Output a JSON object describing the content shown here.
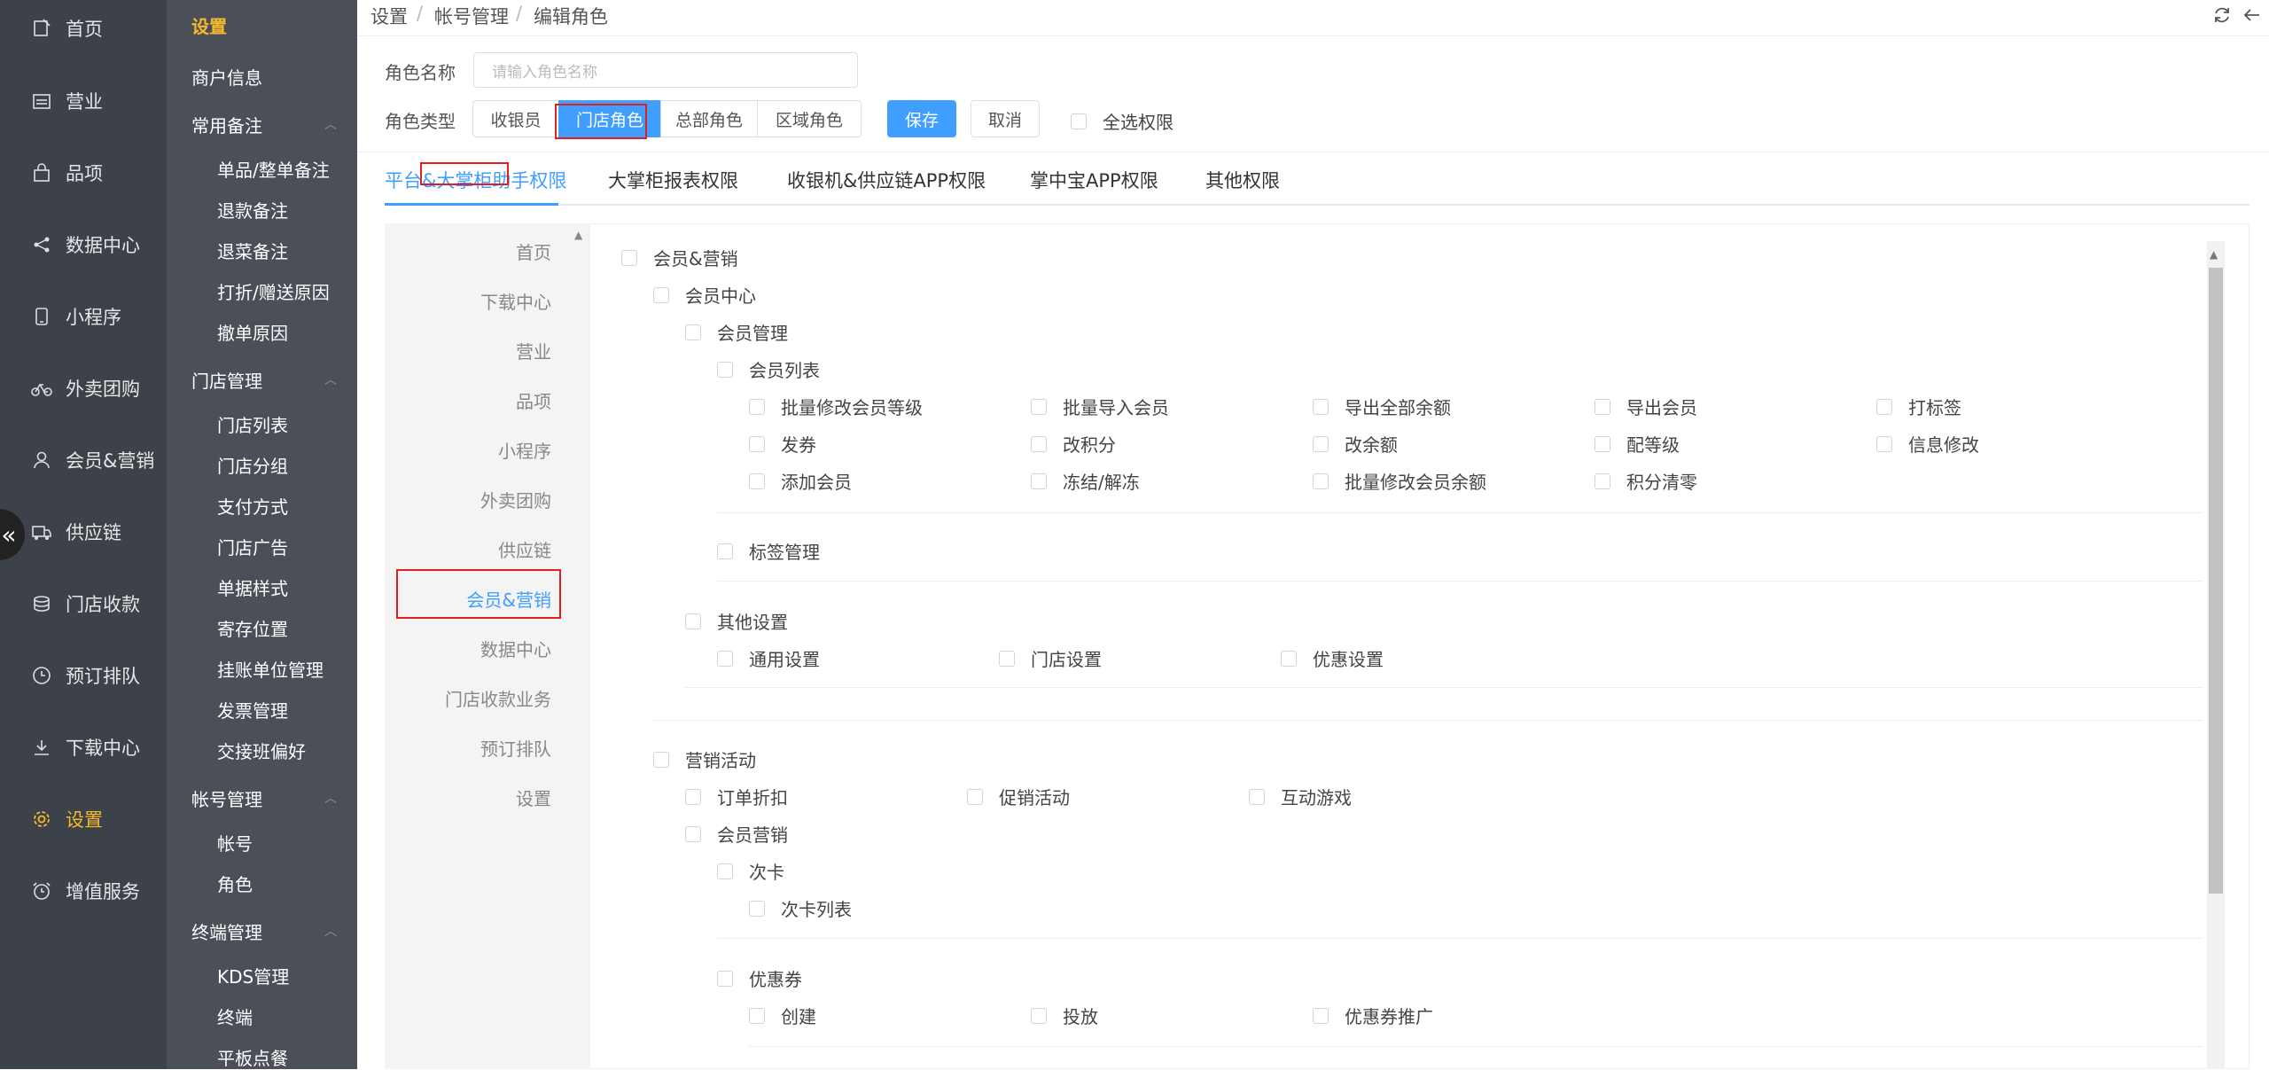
{
  "main_nav": [
    {
      "label": "首页",
      "icon": "home-icon"
    },
    {
      "label": "营业",
      "icon": "calendar-icon"
    },
    {
      "label": "品项",
      "icon": "bag-icon"
    },
    {
      "label": "数据中心",
      "icon": "share-icon"
    },
    {
      "label": "小程序",
      "icon": "phone-icon"
    },
    {
      "label": "外卖团购",
      "icon": "bike-icon"
    },
    {
      "label": "会员&营销",
      "icon": "user-icon"
    },
    {
      "label": "供应链",
      "icon": "truck-icon"
    },
    {
      "label": "门店收款",
      "icon": "coins-icon"
    },
    {
      "label": "预订排队",
      "icon": "clock-icon"
    },
    {
      "label": "下载中心",
      "icon": "download-icon"
    },
    {
      "label": "设置",
      "icon": "gear-icon"
    },
    {
      "label": "增值服务",
      "icon": "alarm-icon"
    }
  ],
  "sub_nav": {
    "title": "设置",
    "merchant": "商户信息",
    "groups": [
      {
        "title": "常用备注",
        "items": [
          "单品/整单备注",
          "退款备注",
          "退菜备注",
          "打折/赠送原因",
          "撤单原因"
        ]
      },
      {
        "title": "门店管理",
        "items": [
          "门店列表",
          "门店分组",
          "支付方式",
          "门店广告",
          "单据样式",
          "寄存位置",
          "挂账单位管理",
          "发票管理",
          "交接班偏好"
        ]
      },
      {
        "title": "帐号管理",
        "items": [
          "帐号",
          "角色"
        ]
      },
      {
        "title": "终端管理",
        "items": [
          "KDS管理",
          "终端",
          "平板点餐"
        ]
      }
    ]
  },
  "breadcrumb": [
    "设置",
    "帐号管理",
    "编辑角色"
  ],
  "breadcrumb_sep": "/",
  "form": {
    "role_name_label": "角色名称",
    "role_name_placeholder": "请输入角色名称",
    "role_type_label": "角色类型",
    "role_types": [
      "收银员",
      "门店角色",
      "总部角色",
      "区域角色"
    ],
    "selected_role_type": "门店角色",
    "save": "保存",
    "cancel": "取消",
    "select_all": "全选权限"
  },
  "tabs": [
    "平台&大掌柜助手权限",
    "大掌柜报表权限",
    "收银机&供应链APP权限",
    "掌中宝APP权限",
    "其他权限"
  ],
  "active_tab": "平台&大掌柜助手权限",
  "categories": [
    "首页",
    "下载中心",
    "营业",
    "品项",
    "小程序",
    "外卖团购",
    "供应链",
    "会员&营销",
    "数据中心",
    "门店收款业务",
    "预订排队",
    "设置"
  ],
  "active_category": "会员&营销",
  "perms": {
    "root": "会员&营销",
    "member_center": "会员中心",
    "member_mgmt": "会员管理",
    "member_list": "会员列表",
    "member_list_items": [
      "批量修改会员等级",
      "批量导入会员",
      "导出全部余额",
      "导出会员",
      "打标签",
      "发券",
      "改积分",
      "改余额",
      "配等级",
      "信息修改",
      "添加会员",
      "冻结/解冻",
      "批量修改会员余额",
      "积分清零"
    ],
    "tag_mgmt": "标签管理",
    "other_settings": "其他设置",
    "other_settings_items": [
      "通用设置",
      "门店设置",
      "优惠设置"
    ],
    "marketing": "营销活动",
    "marketing_items": [
      "订单折扣",
      "促销活动",
      "互动游戏"
    ],
    "member_marketing": "会员营销",
    "times_card": "次卡",
    "times_card_list": "次卡列表",
    "coupon": "优惠券",
    "coupon_items": [
      "创建",
      "投放",
      "优惠券推广"
    ]
  }
}
